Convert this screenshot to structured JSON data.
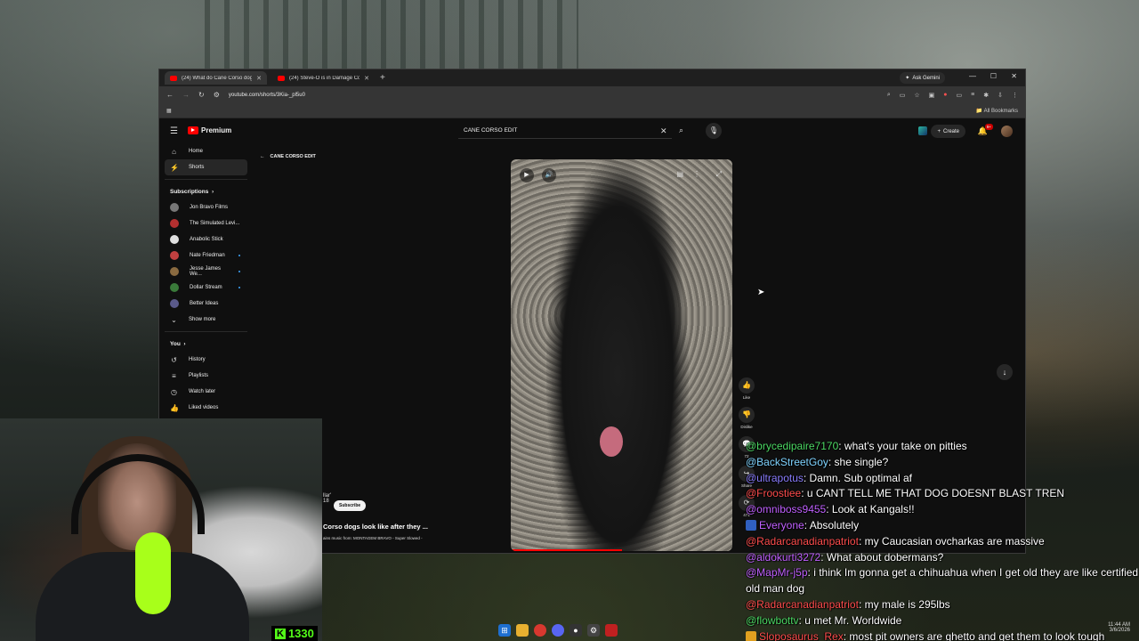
{
  "browser": {
    "tabs": [
      {
        "title": "(24) What do Cane Corso dogs...",
        "active": true
      },
      {
        "title": "(24) Steve-O is in Damage Control",
        "active": false
      }
    ],
    "ask_gemini": "Ask Gemini",
    "url": "youtube.com/shorts/3Kia-_pl5u0",
    "all_bookmarks": "All Bookmarks"
  },
  "youtube": {
    "logo_text": "Premium",
    "search_value": "CANE CORSO EDIT",
    "create_label": "Create",
    "notifications_badge": "9+",
    "back_title": "CANE CORSO EDIT",
    "sidebar": {
      "main": [
        {
          "label": "Home",
          "icon": "home-icon"
        },
        {
          "label": "Shorts",
          "icon": "shorts-icon"
        }
      ],
      "subscriptions_header": "Subscriptions",
      "subscriptions": [
        {
          "label": "Jon Bravo Films",
          "color": "#777777",
          "live": false
        },
        {
          "label": "The Simulated Levi...",
          "color": "#b33030",
          "live": false
        },
        {
          "label": "Anabolic Stick",
          "color": "#e0e0e0",
          "live": false
        },
        {
          "label": "Nate Friedman",
          "color": "#c04040",
          "live": true
        },
        {
          "label": "Jesse James We...",
          "color": "#8a6a40",
          "live": true
        },
        {
          "label": "Dollar Stream",
          "color": "#3a7a3a",
          "live": true
        },
        {
          "label": "Better Ideas",
          "color": "#5a5a8a",
          "live": false
        }
      ],
      "show_more": "Show more",
      "you_header": "You",
      "you_items": [
        {
          "label": "History",
          "icon": "history-icon"
        },
        {
          "label": "Playlists",
          "icon": "playlists-icon"
        },
        {
          "label": "Watch later",
          "icon": "watch-later-icon"
        },
        {
          "label": "Liked videos",
          "icon": "liked-videos-icon"
        }
      ]
    },
    "actions": {
      "like": "Like",
      "dislike": "Dislike",
      "comments": "72",
      "share": "Share",
      "remix": "471"
    },
    "video": {
      "channel_partial": "llar'",
      "count_partial": "18",
      "subscribe": "Subscribe",
      "title": "Corso dogs look like after they ...",
      "music": "ains music from: MONTAGEM BRAVO - Super Slowed -"
    }
  },
  "stream": {
    "kick_count": "1330"
  },
  "chat": [
    {
      "user": "@brycedipaire7170",
      "color": "#4cd964",
      "text": ": what's your take on pitties"
    },
    {
      "user": "@BackStreetGoy",
      "color": "#7fd3ff",
      "text": ": she single?"
    },
    {
      "user": "@ultrapotus",
      "color": "#8a7dff",
      "text": ": Damn. Sub optimal af"
    },
    {
      "user": "@Froostiee",
      "color": "#ff4d4d",
      "text": ": u CANT TELL ME THAT DOG DOESNT BLAST TREN"
    },
    {
      "user": "@omniboss9455",
      "color": "#c060ff",
      "text": ": Look at Kangals!!"
    },
    {
      "user": "Everyone",
      "color": "#c060ff",
      "text": ": Absolutely",
      "icon": "#3060c0"
    },
    {
      "user": "@Radarcanadianpatriot",
      "color": "#ff4d4d",
      "text": ": my Caucasian ovcharkas are massive"
    },
    {
      "user": "@aldokurti3272",
      "color": "#c060ff",
      "text": ": What about dobermans?"
    },
    {
      "user": "@MapMr-j5p",
      "color": "#c060ff",
      "text": ": i think Im gonna get a chihuahua when I get old they are like certified old man dog"
    },
    {
      "user": "@Radarcanadianpatriot",
      "color": "#ff4d4d",
      "text": ": my male is 295lbs"
    },
    {
      "user": "@flowbottv",
      "color": "#4cd964",
      "text": ": u met Mr. Worldwide"
    },
    {
      "user": "Sloposaurus_Rex",
      "color": "#ff4d4d",
      "text": ": most pit owners are ghetto and get them to look tough",
      "icon": "#e0a020"
    }
  ],
  "taskbar": {
    "time": "11:44 AM",
    "date": "3/6/2026"
  }
}
